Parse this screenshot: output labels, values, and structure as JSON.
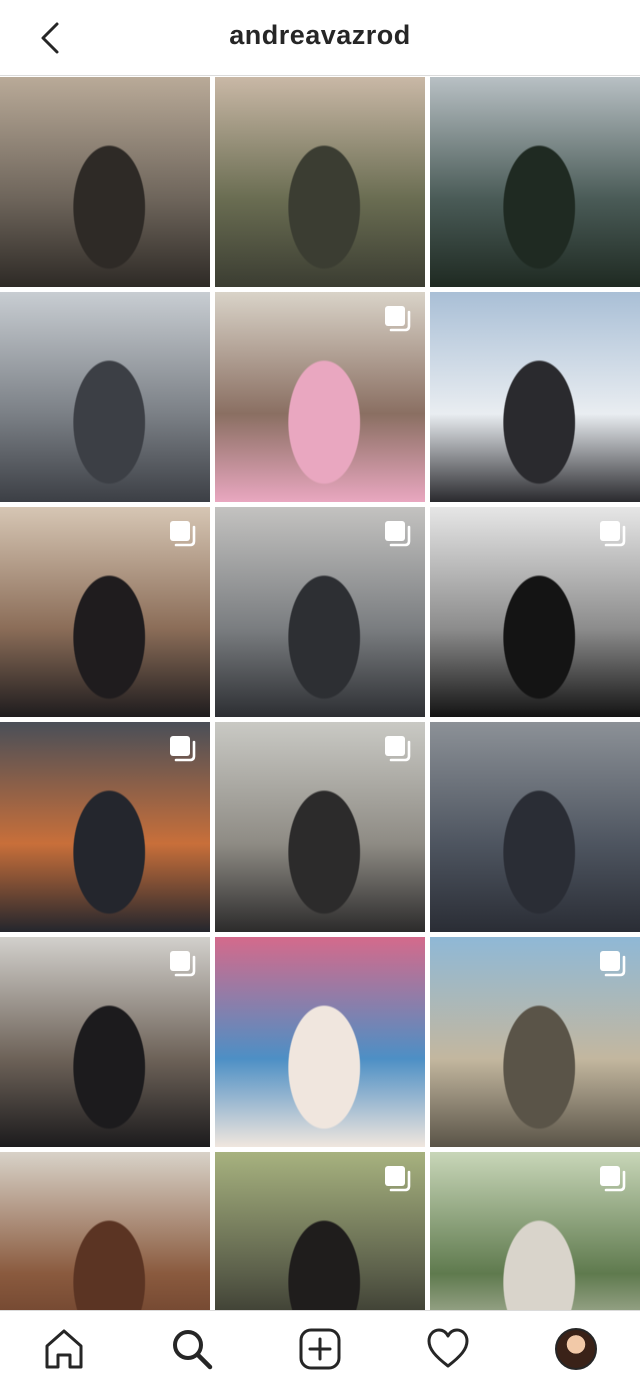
{
  "header": {
    "username": "andreavazrod",
    "back_icon": "chevron-left-icon"
  },
  "posts": [
    {
      "kind": "photo",
      "multi": false,
      "colors": [
        "#b9aa98",
        "#6e655b",
        "#2e2a26"
      ]
    },
    {
      "kind": "photo",
      "multi": false,
      "colors": [
        "#c9b8a6",
        "#6a6d52",
        "#3b3d32"
      ]
    },
    {
      "kind": "photo",
      "multi": false,
      "colors": [
        "#b8c0c4",
        "#4a5b57",
        "#1f2a22"
      ]
    },
    {
      "kind": "photo",
      "multi": false,
      "colors": [
        "#c8cdd2",
        "#7b8086",
        "#3c3f45"
      ]
    },
    {
      "kind": "photo",
      "multi": true,
      "colors": [
        "#d9d3c8",
        "#8a6f62",
        "#e9a7c0"
      ]
    },
    {
      "kind": "photo",
      "multi": false,
      "colors": [
        "#a9bfd6",
        "#e9edf1",
        "#2a2a2e"
      ]
    },
    {
      "kind": "photo",
      "multi": true,
      "colors": [
        "#d6c6b4",
        "#8b6d58",
        "#1f1c1e"
      ]
    },
    {
      "kind": "photo",
      "multi": true,
      "colors": [
        "#c3c2c0",
        "#7a7d80",
        "#2d2f33"
      ]
    },
    {
      "kind": "photo",
      "multi": true,
      "colors": [
        "#e6e6e6",
        "#8c8c8c",
        "#141414"
      ]
    },
    {
      "kind": "photo",
      "multi": true,
      "colors": [
        "#4a4f58",
        "#c86f3a",
        "#24262d"
      ]
    },
    {
      "kind": "photo",
      "multi": true,
      "colors": [
        "#c9c9c4",
        "#8e8b84",
        "#2c2b2b"
      ]
    },
    {
      "kind": "photo",
      "multi": false,
      "colors": [
        "#8c9197",
        "#4e5560",
        "#2a2d35"
      ]
    },
    {
      "kind": "photo",
      "multi": true,
      "colors": [
        "#d2d0cc",
        "#6d6258",
        "#1c1b1d"
      ]
    },
    {
      "kind": "photo",
      "multi": false,
      "colors": [
        "#d46a8b",
        "#4d8fc5",
        "#f0e6de"
      ]
    },
    {
      "kind": "photo",
      "multi": true,
      "colors": [
        "#8fb8d6",
        "#c3b79f",
        "#5a5448"
      ]
    },
    {
      "kind": "photo",
      "multi": false,
      "colors": [
        "#d8d2c8",
        "#8a5a3e",
        "#5b3423"
      ]
    },
    {
      "kind": "photo",
      "multi": true,
      "colors": [
        "#a7b27f",
        "#5b5f4a",
        "#1f1d1c"
      ]
    },
    {
      "kind": "photo",
      "multi": true,
      "colors": [
        "#c8d6b8",
        "#5f7a4e",
        "#d9d4cb"
      ]
    },
    {
      "kind": "photo",
      "multi": false,
      "colors": [
        "#4b4f55",
        "#6a6e75",
        "#3c3f44"
      ]
    },
    {
      "kind": "photo",
      "multi": false,
      "colors": [
        "#6f7276",
        "#9aa0a6",
        "#4a4d52"
      ]
    },
    {
      "kind": "photo",
      "multi": false,
      "colors": [
        "#3d6fa3",
        "#8fb2d1",
        "#2a3b4e"
      ]
    }
  ],
  "bottom_nav": {
    "items": [
      {
        "name": "home",
        "icon": "home-icon"
      },
      {
        "name": "search",
        "icon": "search-icon"
      },
      {
        "name": "new-post",
        "icon": "add-post-icon"
      },
      {
        "name": "activity",
        "icon": "heart-icon"
      },
      {
        "name": "profile",
        "icon": "avatar"
      }
    ]
  }
}
